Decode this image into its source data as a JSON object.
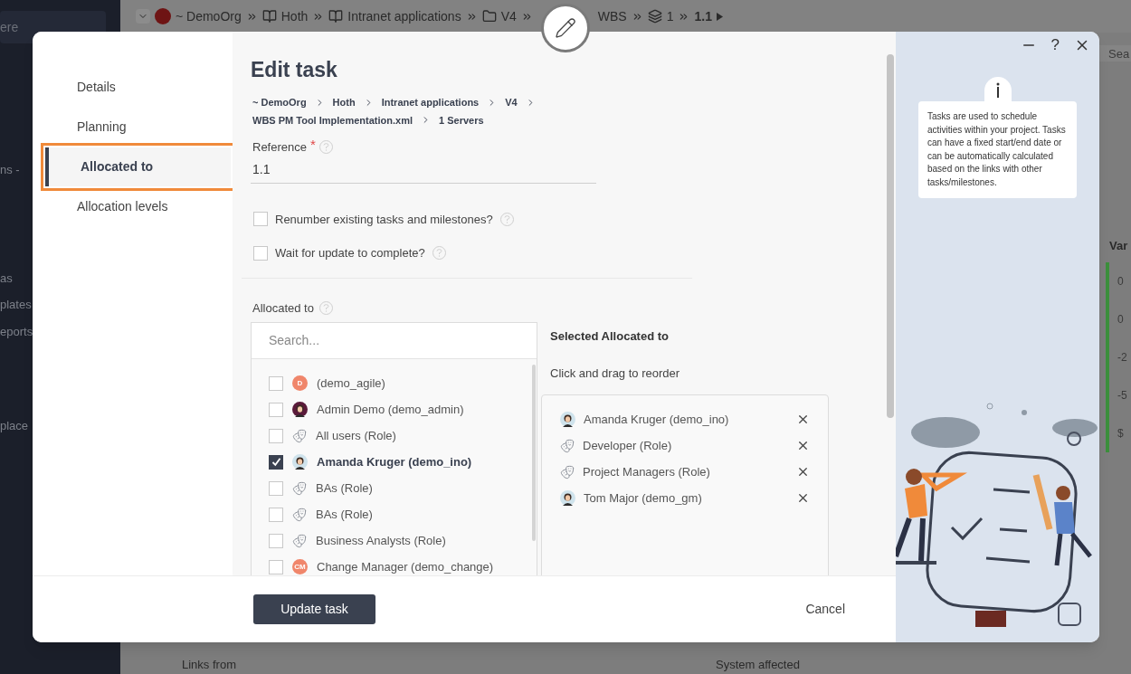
{
  "background": {
    "breadcrumb": [
      {
        "label": "~ DemoOrg",
        "kind": "org"
      },
      {
        "label": "Hoth",
        "kind": "book"
      },
      {
        "label": "Intranet applications",
        "kind": "book"
      },
      {
        "label": "V4",
        "kind": "folder"
      },
      {
        "label": "WBS",
        "kind": "book"
      },
      {
        "label": "1",
        "kind": "stack"
      },
      {
        "label": "1.1",
        "kind": "current"
      }
    ],
    "sidebar_search": "ere",
    "sidebar_items": [
      "ns -",
      "as",
      "plates",
      "eports",
      "place"
    ],
    "search_fragment": "Sea",
    "column_header": "Var",
    "column_values": [
      "0",
      "0",
      "-2",
      "-5",
      "$"
    ],
    "bottom_labels": [
      "Links from",
      "System affected"
    ]
  },
  "modal": {
    "nav": [
      {
        "label": "Details",
        "selected": false
      },
      {
        "label": "Planning",
        "selected": false
      },
      {
        "label": "Allocated to",
        "selected": true
      },
      {
        "label": "Allocation levels",
        "selected": false
      }
    ],
    "title": "Edit task",
    "path": [
      "~ DemoOrg",
      "Hoth",
      "Intranet applications",
      "V4",
      "WBS PM Tool Implementation.xml",
      "1 Servers"
    ],
    "reference": {
      "label": "Reference",
      "required_mark": "*",
      "value": "1.1"
    },
    "options": [
      {
        "label": "Renumber existing tasks and milestones?",
        "checked": false
      },
      {
        "label": "Wait for update to complete?",
        "checked": false
      }
    ],
    "allocated_to": {
      "label": "Allocated to",
      "placeholder": "Search...",
      "items": [
        {
          "label": "(demo_agile)",
          "checked": false,
          "kind": "initials",
          "initials": "D",
          "color": "#f0866b"
        },
        {
          "label": "Admin Demo (demo_admin)",
          "checked": false,
          "kind": "photo",
          "color": "#5a1a3a"
        },
        {
          "label": "All users (Role)",
          "checked": false,
          "kind": "role"
        },
        {
          "label": "Amanda Kruger (demo_ino)",
          "checked": true,
          "kind": "photo",
          "color": "#cfe3ec"
        },
        {
          "label": "BAs (Role)",
          "checked": false,
          "kind": "role"
        },
        {
          "label": "BAs (Role)",
          "checked": false,
          "kind": "role"
        },
        {
          "label": "Business Analysts (Role)",
          "checked": false,
          "kind": "role"
        },
        {
          "label": "Change Manager (demo_change)",
          "checked": false,
          "kind": "initials",
          "initials": "CM",
          "color": "#f0866b"
        }
      ]
    },
    "selected": {
      "title": "Selected Allocated to",
      "hint": "Click and drag to reorder",
      "items": [
        {
          "label": "Amanda Kruger (demo_ino)",
          "kind": "photo",
          "color": "#cfe3ec"
        },
        {
          "label": "Developer (Role)",
          "kind": "role"
        },
        {
          "label": "Project Managers (Role)",
          "kind": "role"
        },
        {
          "label": "Tom Major (demo_gm)",
          "kind": "photo",
          "color": "#cfe3ec"
        }
      ]
    },
    "primary_button": "Update task",
    "cancel_button": "Cancel",
    "help_label": "?",
    "help_text": "Tasks are used to schedule activities within your project. Tasks can have a fixed start/end date or can be automatically calculated based on the links with other tasks/milestones."
  }
}
